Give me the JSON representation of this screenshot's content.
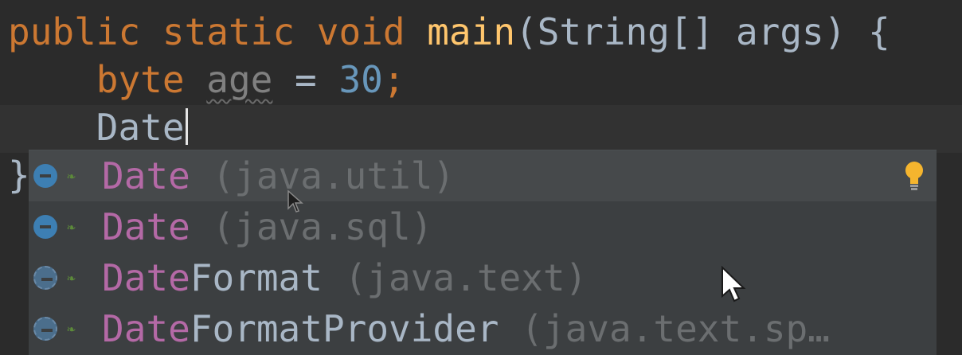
{
  "editor": {
    "line1": {
      "kw_public": "public",
      "kw_static": "static",
      "kw_void": "void",
      "method_name": "main",
      "signature_rest": "(String[] args) {"
    },
    "line2": {
      "indent": "    ",
      "kw_byte": "byte",
      "var_name": "age",
      "assign": " = ",
      "number": "30",
      "semicolon": ";"
    },
    "line3": {
      "indent": "    ",
      "typed_text": "Date"
    },
    "line4": {
      "closing_brace": "}"
    }
  },
  "completion_popup": {
    "items": [
      {
        "match": "Date",
        "rest": "",
        "package": " (java.util)",
        "selected": true,
        "icon": "class-icon"
      },
      {
        "match": "Date",
        "rest": "",
        "package": " (java.sql)",
        "selected": false,
        "icon": "class-icon"
      },
      {
        "match": "Date",
        "rest": "Format",
        "package": " (java.text)",
        "selected": false,
        "icon": "abstract-class-icon"
      },
      {
        "match": "Date",
        "rest": "FormatProvider",
        "package": " (java.text.sp…",
        "selected": false,
        "icon": "abstract-class-icon"
      }
    ],
    "hint_icon": "lightbulb-icon"
  },
  "colors": {
    "background": "#2b2b2b",
    "keyword": "#cc7832",
    "method": "#ffc66d",
    "number": "#6897bb",
    "match_highlight": "#b469a6",
    "popup_bg": "#3c3f41",
    "selected_bg": "#46494b"
  }
}
